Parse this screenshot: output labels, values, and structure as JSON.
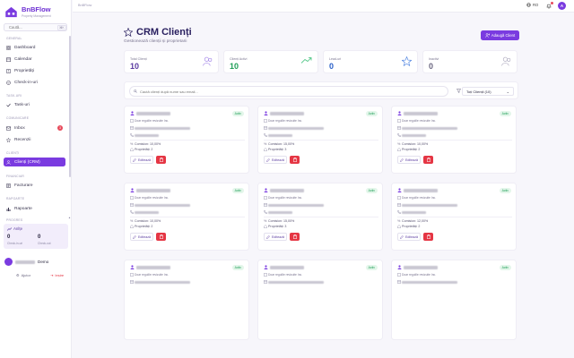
{
  "brand": {
    "name": "BnBFlow",
    "tagline": "Property Management"
  },
  "sidebar": {
    "search_placeholder": "Caută...",
    "search_kbd": "⌘K",
    "sections": {
      "general": "GENERAL",
      "tasks": "TASK-URI",
      "communication": "COMUNICARE",
      "clients": "CLIENȚI",
      "financial": "FINANCIAR",
      "reports": "RAPOARTE",
      "progress": "PROGRES"
    },
    "items": {
      "dashboard": "Dashboard",
      "calendar": "Calendar",
      "properties": "Proprietăți",
      "checkin": "Check-in-uri",
      "tasks": "Task-uri",
      "inbox": "Inbox",
      "inbox_badge": "3",
      "reviews": "Recenzii",
      "clients": "Clienți (CRM)",
      "invoices": "Facturare",
      "reports": "Rapoarte"
    },
    "progress": {
      "title": "Anlțe",
      "left_value": "0",
      "left_label": "Check-in-uri",
      "right_value": "0",
      "right_label": "Check-out"
    },
    "user": {
      "name_suffix": "Demo"
    },
    "footer": {
      "help": "Ajutor",
      "logout": "Ieșire"
    }
  },
  "topbar": {
    "app": "BnBFlow",
    "lang": "RO",
    "avatar_letter": "A"
  },
  "page": {
    "title": "CRM Clienți",
    "subtitle": "Gestionează clienții și proprietarii",
    "add_button": "Adaugă Client"
  },
  "stats": [
    {
      "label": "Total Clienți",
      "value": "10",
      "color": "#5a3aa0"
    },
    {
      "label": "Clienți Activi",
      "value": "10",
      "color": "#1e9e56"
    },
    {
      "label": "Lead-uri",
      "value": "0",
      "color": "#2a60c8"
    },
    {
      "label": "Inactivi",
      "value": "0",
      "color": "#6a6680"
    }
  ],
  "filter": {
    "search_placeholder": "Caută clienți după nume sau email...",
    "select_value": "Toți Clienții (10)"
  },
  "cards": [
    {
      "status": "Activ",
      "rule": "Doar regulile revizuite Inc.",
      "commission": "Comision: 10,00%",
      "properties": "Proprietăți: 2",
      "edit": "Editează"
    },
    {
      "status": "Activ",
      "rule": "Doar regulile revizuite Inc.",
      "commission": "Comision: 15,00%",
      "properties": "Proprietăți: 3",
      "edit": "Editează"
    },
    {
      "status": "Activ",
      "rule": "Doar regulile revizuite Inc.",
      "commission": "Comision: 10,00%",
      "properties": "Proprietăți: 2",
      "edit": "Editează"
    },
    {
      "status": "Activ",
      "rule": "Doar regulile revizuite Inc.",
      "commission": "Comision: 10,00%",
      "properties": "Proprietăți: 2",
      "edit": "Editează"
    },
    {
      "status": "Activ",
      "rule": "Doar regulile revizuite Inc.",
      "commission": "Comision: 15,00%",
      "properties": "Proprietăți: 3",
      "edit": "Editează"
    },
    {
      "status": "Activ",
      "rule": "Doar regulile revizuite Inc.",
      "commission": "Comision: 12,00%",
      "properties": "Proprietăți: 2",
      "edit": "Editează"
    },
    {
      "status": "Activ",
      "rule": "Doar regulile revizuite Inc."
    },
    {
      "status": "Activ",
      "rule": "Doar regulile revizuite Inc."
    },
    {
      "status": "Activ",
      "rule": "Doar regulile revizuite Inc."
    }
  ],
  "colors": {
    "accent": "#7a3be0",
    "danger": "#e53644",
    "success": "#1e9e56"
  }
}
